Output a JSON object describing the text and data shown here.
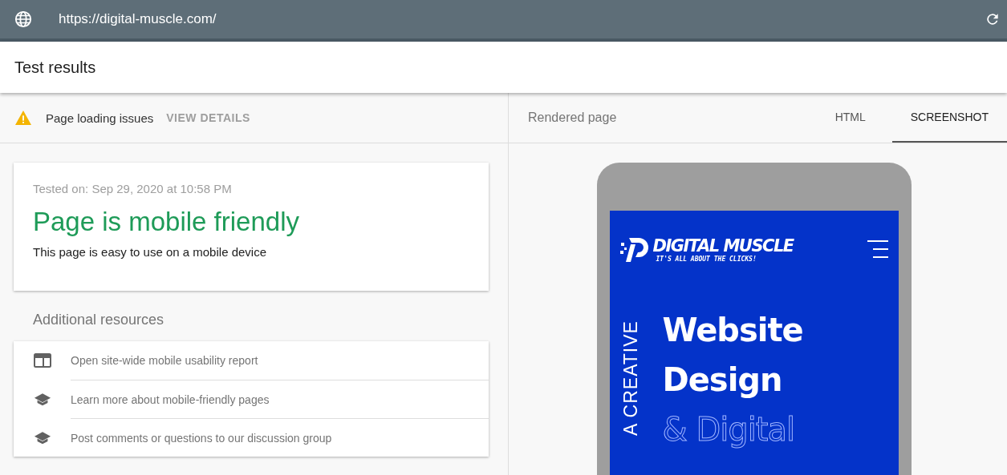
{
  "address_bar": {
    "url": "https://digital-muscle.com/"
  },
  "header": {
    "title": "Test results"
  },
  "issues_bar": {
    "label": "Page loading issues",
    "action": "VIEW DETAILS"
  },
  "result_card": {
    "tested_on": "Tested on: Sep 29, 2020 at 10:58 PM",
    "verdict": "Page is mobile friendly",
    "description": "This page is easy to use on a mobile device"
  },
  "resources": {
    "title": "Additional resources",
    "items": [
      {
        "kind": "report",
        "label": "Open site-wide mobile usability report"
      },
      {
        "kind": "learn",
        "label": "Learn more about mobile-friendly pages"
      },
      {
        "kind": "learn",
        "label": "Post comments or questions to our discussion group"
      }
    ]
  },
  "rendered": {
    "title": "Rendered page",
    "tabs": [
      {
        "label": "HTML",
        "selected": false
      },
      {
        "label": "SCREENSHOT",
        "selected": true
      }
    ]
  },
  "phone_screen": {
    "logo_name": "DIGITAL MUSCLE",
    "logo_tagline": "IT'S ALL ABOUT THE CLICKS!",
    "side_text": "A CREATIVE",
    "headline": [
      "Website",
      "Design"
    ],
    "outline_line": "& Digital"
  }
}
